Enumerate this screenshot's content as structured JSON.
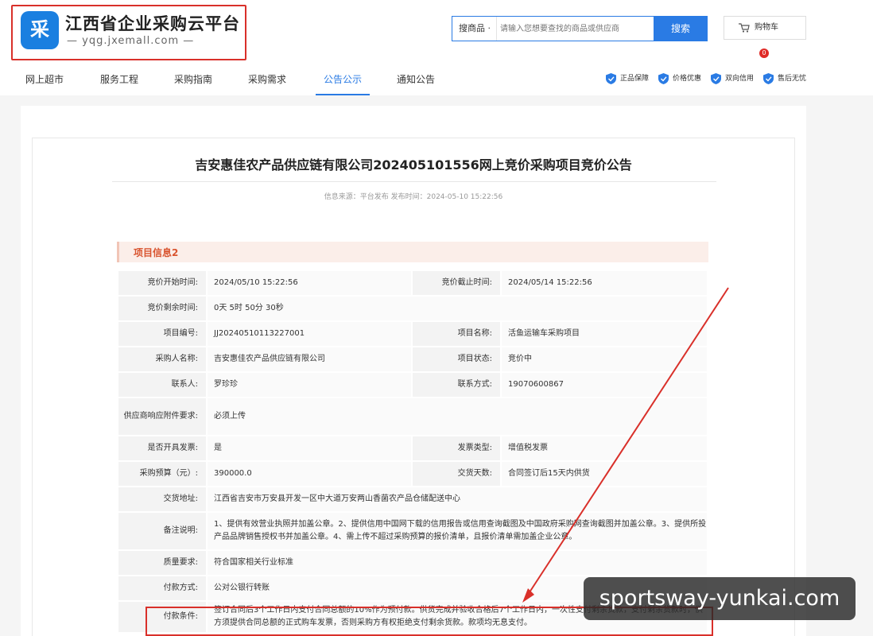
{
  "header": {
    "logo_glyph": "采",
    "site_title": "江西省企业采购云平台",
    "site_url": "— yqg.jxemall.com —"
  },
  "search": {
    "category": "搜商品 ·",
    "placeholder": "请输入您想要查找的商品或供应商",
    "button": "搜索"
  },
  "cart": {
    "label": "购物车",
    "count": "0"
  },
  "nav": {
    "items": [
      "网上超市",
      "服务工程",
      "采购指南",
      "采购需求",
      "公告公示",
      "通知公告"
    ],
    "active": "公告公示"
  },
  "guarantees": [
    "正品保障",
    "价格优惠",
    "双向信用",
    "售后无忧"
  ],
  "notice": {
    "title": "吉安惠佳农产品供应链有限公司202405101556网上竞价采购项目竞价公告",
    "meta": "信息来源：平台发布 发布时间：2024-05-10 15:22:56",
    "section_title": "项目信息2"
  },
  "rows": {
    "start_label": "竞价开始时间:",
    "start_value": "2024/05/10 15:22:56",
    "end_label": "竞价截止时间:",
    "end_value": "2024/05/14 15:22:56",
    "remain_label": "竞价剩余时间:",
    "remain_value": "0天 5时 50分 30秒",
    "code_label": "项目编号:",
    "code_value": "JJ20240510113227001",
    "name_label": "项目名称:",
    "name_value": "活鱼运输车采购项目",
    "buyer_label": "采购人名称:",
    "buyer_value": "吉安惠佳农产品供应链有限公司",
    "status_label": "项目状态:",
    "status_value": "竞价中",
    "contact_label": "联系人:",
    "contact_value": "罗珍珍",
    "phone_label": "联系方式:",
    "phone_value": "19070600867",
    "attach_label": "供应商响应附件要求:",
    "attach_value": "必须上传",
    "invoice_label": "是否开具发票:",
    "invoice_value": "是",
    "invoice_type_label": "发票类型:",
    "invoice_type_value": "增值税发票",
    "budget_label": "采购预算（元）:",
    "budget_value": "390000.0",
    "delivery_days_label": "交货天数:",
    "delivery_days_value": "合同签订后15天内供货",
    "address_label": "交货地址:",
    "address_value": "江西省吉安市万安县开发一区中大道万安两山香菌农产品仓储配送中心",
    "remark_label": "备注说明:",
    "remark_value": "1、提供有效营业执照并加盖公章。2、提供信用中国网下载的信用报告或信用查询截图及中国政府采购网查询截图并加盖公章。3、提供所投产品品牌销售授权书并加盖公章。4、需上传不超过采购预算的报价清单，且报价清单需加盖企业公章。",
    "quality_label": "质量要求:",
    "quality_value": "符合国家相关行业标准",
    "pay_method_label": "付款方式:",
    "pay_method_value": "公对公银行转账",
    "pay_terms_label": "付款条件:",
    "pay_terms_value": "签订合同后3个工作日内支付合同总额的10%作为预付款。供货完成并验收合格后7个工作日内，一次性支付剩余货款，支付剩余货款时，供方须提供合同总额的正式购车发票，否则采购方有权拒绝支付剩余货款。款项均无息支付。"
  },
  "watermark": "sportsway-yunkai.com",
  "colors": {
    "accent": "#2a7be4",
    "highlight": "#d9302a"
  }
}
